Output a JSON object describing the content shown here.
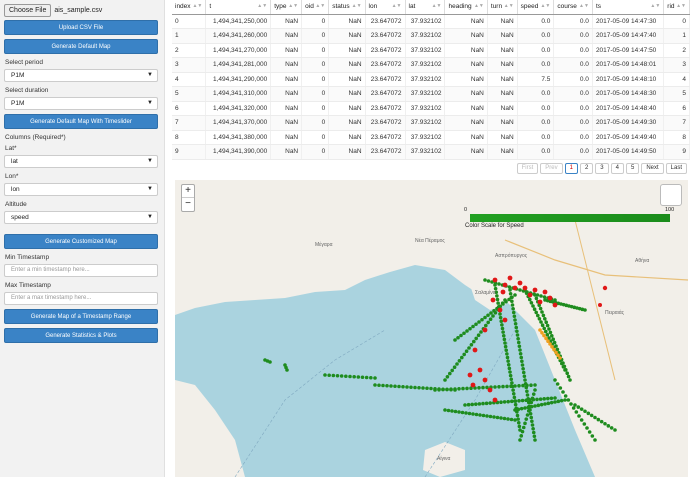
{
  "sidebar": {
    "choose_file": "Choose File",
    "file_name": "ais_sample.csv",
    "upload_btn": "Upload CSV File",
    "default_map_btn": "Generate Default Map",
    "period_label": "Select period",
    "period_value": "P1M",
    "duration_label": "Select duration",
    "duration_value": "P1M",
    "timeslider_btn": "Generate Default Map With Timeslider",
    "columns_label": "Columns (Required*)",
    "lat_label": "Lat*",
    "lat_value": "lat",
    "lon_label": "Lon*",
    "lon_value": "lon",
    "altitude_label": "Altitude",
    "altitude_value": "speed",
    "customized_btn": "Generate Customized Map",
    "min_ts_label": "Min Timestamp",
    "min_ts_placeholder": "Enter a min timestamp here...",
    "max_ts_label": "Max Timestamp",
    "max_ts_placeholder": "Enter a max timestamp here...",
    "range_btn": "Generate Map of a Timestamp Range",
    "stats_btn": "Generate Statistics & Plots"
  },
  "table": {
    "headers": [
      "index",
      "t",
      "type",
      "oid",
      "status",
      "lon",
      "lat",
      "heading",
      "turn",
      "speed",
      "course",
      "ts",
      "rid"
    ],
    "rows": [
      [
        "0",
        "1,494,341,250,000",
        "NaN",
        "0",
        "NaN",
        "23.647072",
        "37.932102",
        "NaN",
        "NaN",
        "0.0",
        "0.0",
        "2017-05-09 14:47:30",
        "0"
      ],
      [
        "1",
        "1,494,341,260,000",
        "NaN",
        "0",
        "NaN",
        "23.647072",
        "37.932102",
        "NaN",
        "NaN",
        "0.0",
        "0.0",
        "2017-05-09 14:47:40",
        "1"
      ],
      [
        "2",
        "1,494,341,270,000",
        "NaN",
        "0",
        "NaN",
        "23.647072",
        "37.932102",
        "NaN",
        "NaN",
        "0.0",
        "0.0",
        "2017-05-09 14:47:50",
        "2"
      ],
      [
        "3",
        "1,494,341,281,000",
        "NaN",
        "0",
        "NaN",
        "23.647072",
        "37.932102",
        "NaN",
        "NaN",
        "0.0",
        "0.0",
        "2017-05-09 14:48:01",
        "3"
      ],
      [
        "4",
        "1,494,341,290,000",
        "NaN",
        "0",
        "NaN",
        "23.647072",
        "37.932102",
        "NaN",
        "NaN",
        "7.5",
        "0.0",
        "2017-05-09 14:48:10",
        "4"
      ],
      [
        "5",
        "1,494,341,310,000",
        "NaN",
        "0",
        "NaN",
        "23.647072",
        "37.932102",
        "NaN",
        "NaN",
        "0.0",
        "0.0",
        "2017-05-09 14:48:30",
        "5"
      ],
      [
        "6",
        "1,494,341,320,000",
        "NaN",
        "0",
        "NaN",
        "23.647072",
        "37.932102",
        "NaN",
        "NaN",
        "0.0",
        "0.0",
        "2017-05-09 14:48:40",
        "6"
      ],
      [
        "7",
        "1,494,341,370,000",
        "NaN",
        "0",
        "NaN",
        "23.647072",
        "37.932102",
        "NaN",
        "NaN",
        "0.0",
        "0.0",
        "2017-05-09 14:49:30",
        "7"
      ],
      [
        "8",
        "1,494,341,380,000",
        "NaN",
        "0",
        "NaN",
        "23.647072",
        "37.932102",
        "NaN",
        "NaN",
        "0.0",
        "0.0",
        "2017-05-09 14:49:40",
        "8"
      ],
      [
        "9",
        "1,494,341,390,000",
        "NaN",
        "0",
        "NaN",
        "23.647072",
        "37.932102",
        "NaN",
        "NaN",
        "0.0",
        "0.0",
        "2017-05-09 14:49:50",
        "9"
      ]
    ]
  },
  "pager": {
    "first": "First",
    "prev": "Prev",
    "pages": [
      "1",
      "2",
      "3",
      "4",
      "5"
    ],
    "next": "Next",
    "last": "Last"
  },
  "map": {
    "zoom_in": "+",
    "zoom_out": "−",
    "scale_min": "0",
    "scale_max": "100",
    "scale_caption": "Color Scale for Speed",
    "places": [
      "Μέγαρα",
      "Νέα Πέραμος",
      "Σαλαμίνα",
      "Αθήνα",
      "Πειραιάς",
      "Ασπρόπυργος",
      "Αίγινα"
    ],
    "colors": {
      "track": "#1e8c1e",
      "stopped": "#e01818",
      "fast": "#f0a020",
      "sea": "#aad3df",
      "land": "#f2efe9"
    }
  }
}
